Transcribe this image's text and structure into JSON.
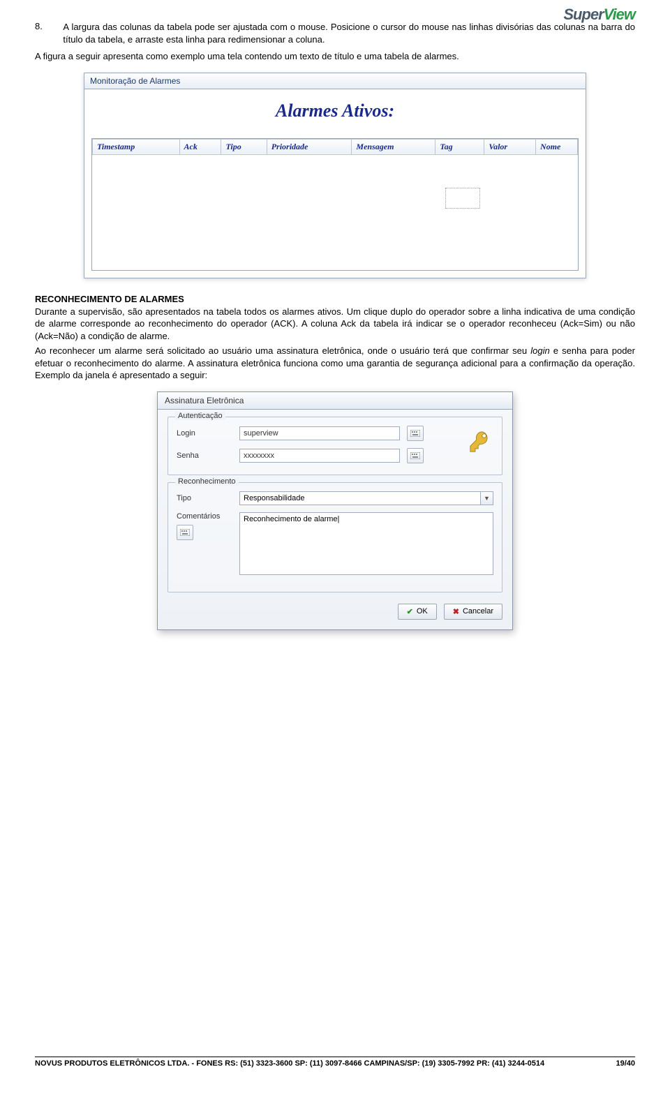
{
  "logo": {
    "brand_p1": "Super",
    "brand_p2": "View"
  },
  "list8": {
    "num": "8.",
    "text": "A largura das colunas da tabela pode ser ajustada com o mouse. Posicione o cursor do mouse nas linhas divisórias das colunas na barra do título da tabela, e arraste esta linha para redimensionar a coluna."
  },
  "intro_after": "A figura a seguir apresenta como exemplo uma tela contendo um texto de título e uma tabela de alarmes.",
  "alarm_window": {
    "title": "Monitoração de Alarmes",
    "heading": "Alarmes Ativos:",
    "columns": [
      "Timestamp",
      "Ack",
      "Tipo",
      "Prioridade",
      "Mensagem",
      "Tag",
      "Valor",
      "Nome"
    ]
  },
  "section_heading": "RECONHECIMENTO DE ALARMES",
  "para1": "Durante a supervisão, são apresentados na tabela todos os alarmes ativos. Um clique duplo do operador sobre a linha indicativa de uma condição de alarme corresponde ao reconhecimento do operador (ACK). A coluna Ack da tabela irá indicar se o operador reconheceu (Ack=Sim) ou não (Ack=Não) a condição de alarme.",
  "para2a": "Ao reconhecer um alarme será solicitado ao usuário uma assinatura eletrônica, onde o usuário terá que confirmar seu ",
  "para2_login": "login",
  "para2b": " e senha para poder efetuar o reconhecimento do alarme. A assinatura eletrônica funciona como uma garantia de segurança adicional para a confirmação da operação. Exemplo da janela é apresentado a seguir:",
  "sig": {
    "title": "Assinatura Eletrônica",
    "auth_legend": "Autenticação",
    "login_label": "Login",
    "login_value": "superview",
    "senha_label": "Senha",
    "senha_value": "xxxxxxxx",
    "rec_legend": "Reconhecimento",
    "tipo_label": "Tipo",
    "tipo_value": "Responsabilidade",
    "coment_label": "Comentários",
    "coment_value": "Reconhecimento de alarme|",
    "ok_label": "OK",
    "cancel_label": "Cancelar"
  },
  "footer": {
    "line": "NOVUS PRODUTOS ELETRÔNICOS LTDA. -  FONES  RS: (51) 3323-3600  SP: (11) 3097-8466  CAMPINAS/SP: (19) 3305-7992  PR: (41) 3244-0514",
    "page": "19/40"
  }
}
